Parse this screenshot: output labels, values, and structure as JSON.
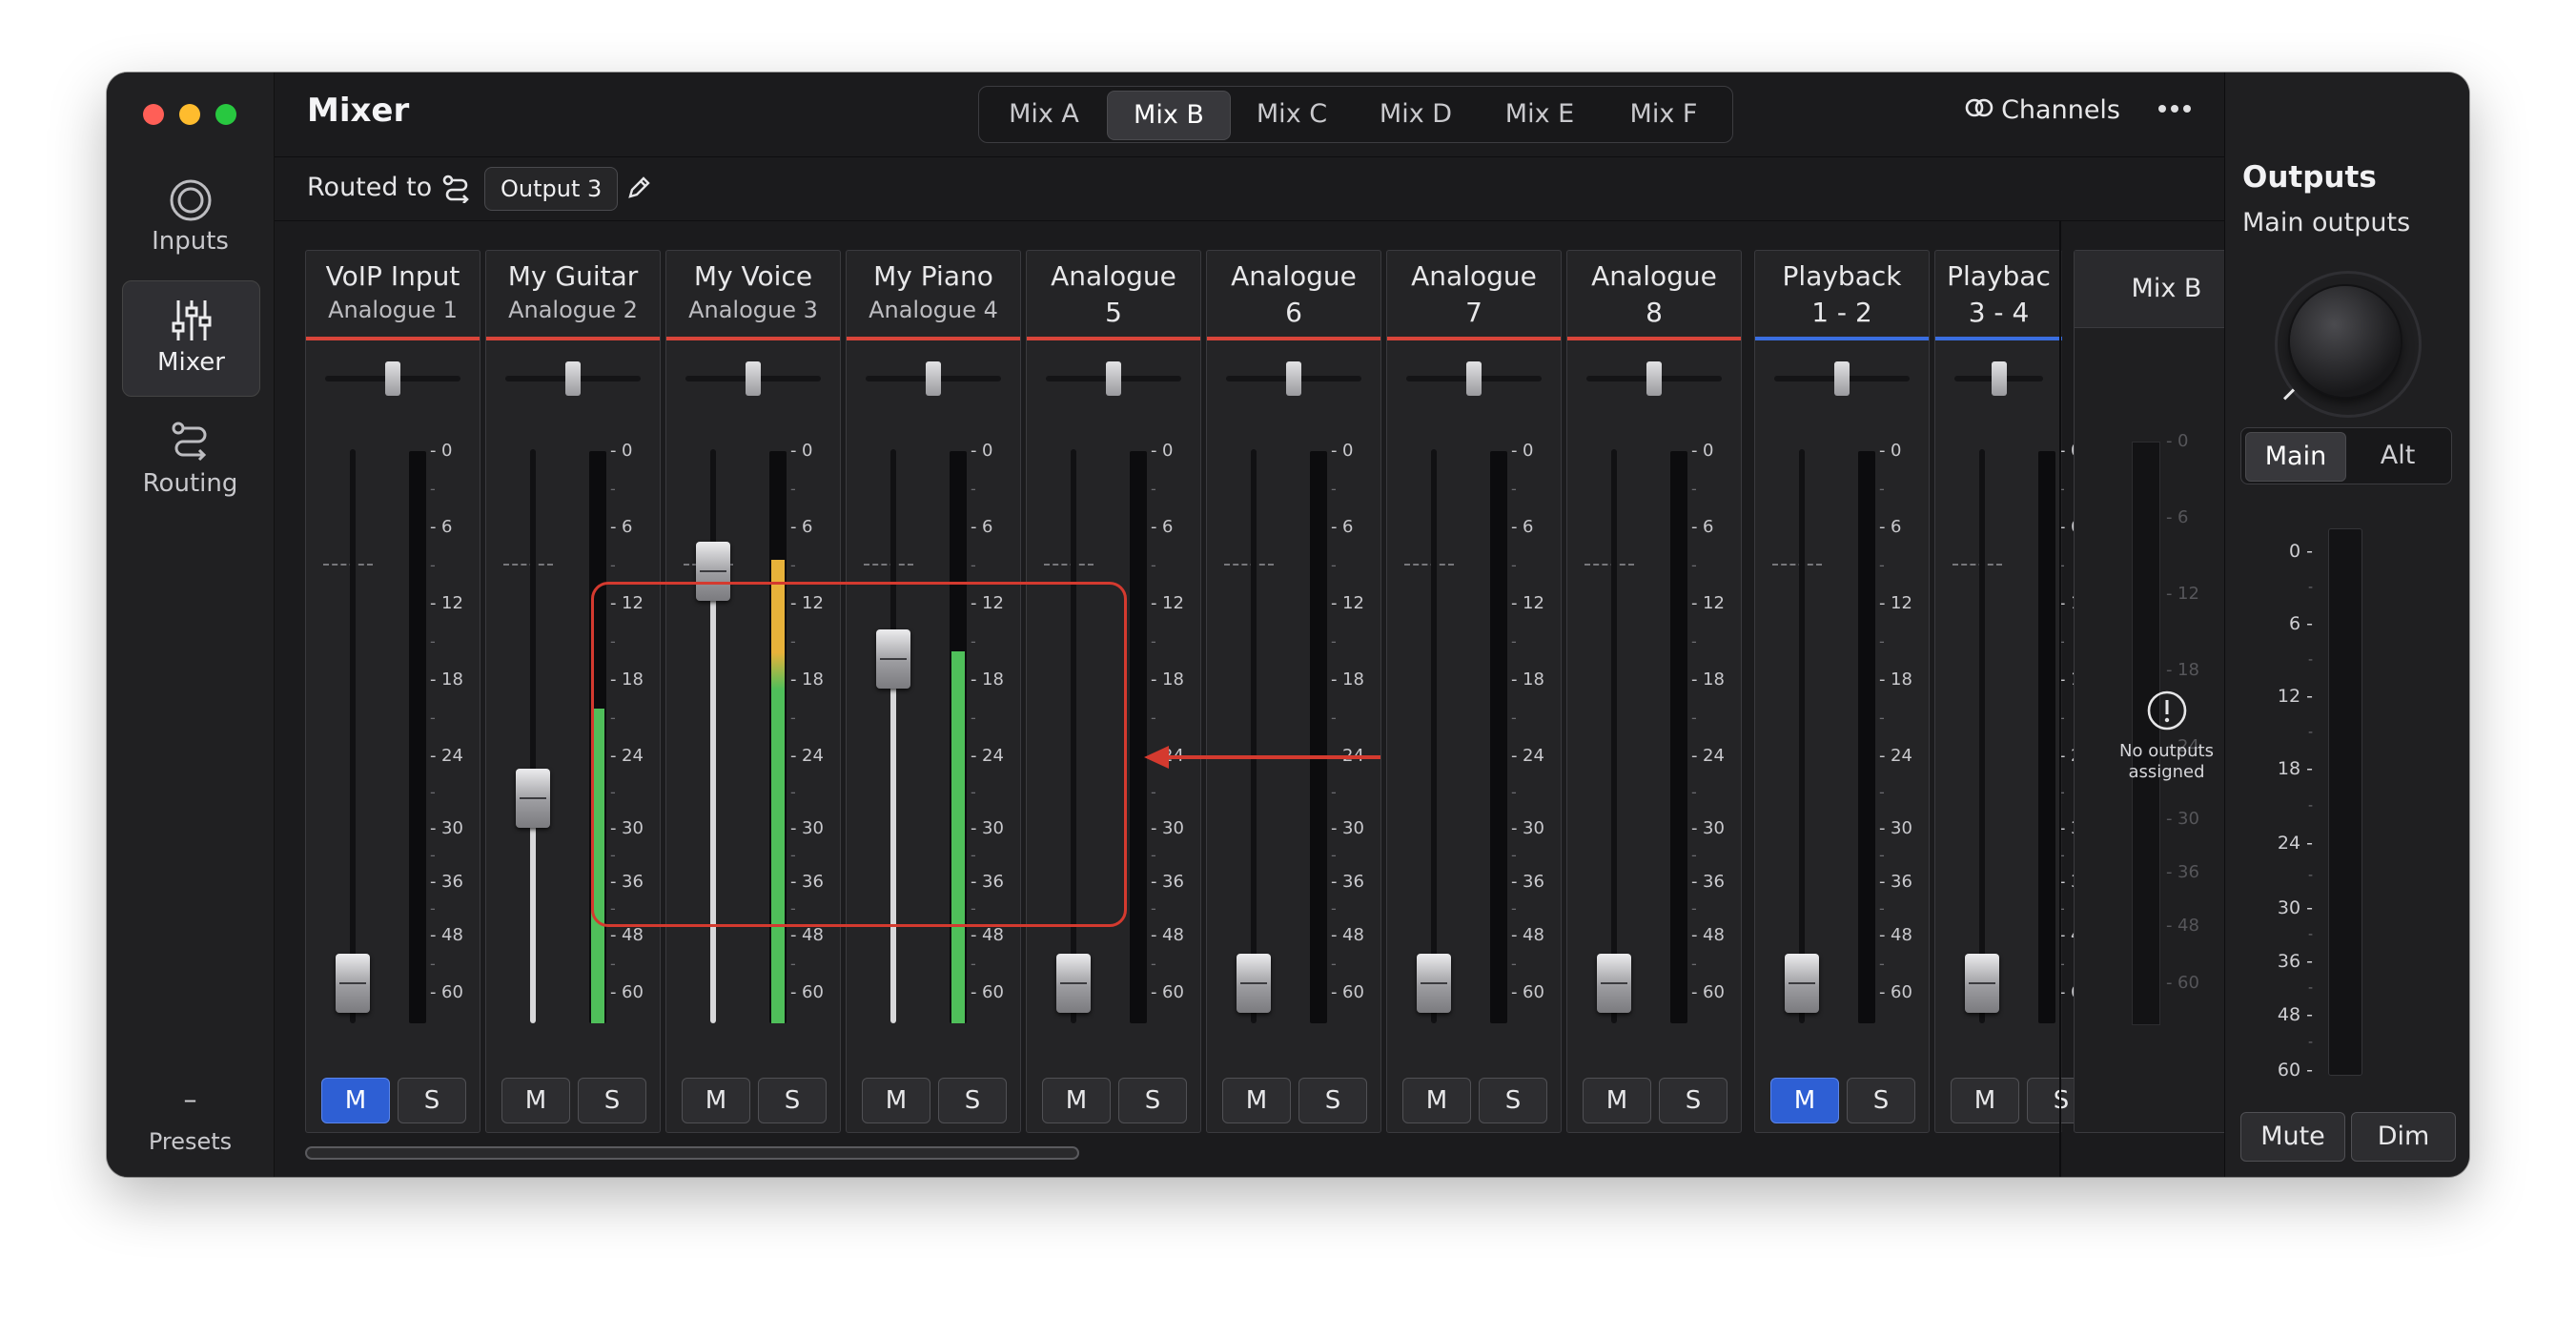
{
  "app": {
    "title": "Mixer"
  },
  "sidebar": {
    "items": [
      {
        "label": "Inputs",
        "icon": "inputs-icon"
      },
      {
        "label": "Mixer",
        "icon": "mixer-sliders-icon",
        "active": true
      },
      {
        "label": "Routing",
        "icon": "routing-icon"
      }
    ],
    "presets": {
      "dash": "–",
      "label": "Presets"
    }
  },
  "tabs": [
    "Mix A",
    "Mix B",
    "Mix C",
    "Mix D",
    "Mix E",
    "Mix F"
  ],
  "active_tab": "Mix B",
  "header": {
    "channels_label": "Channels",
    "more_icon": "more-icon"
  },
  "routing": {
    "label": "Routed to",
    "output": "Output 3"
  },
  "meter_scale": [
    "0",
    "6",
    "12",
    "18",
    "24",
    "30",
    "36",
    "48",
    "60"
  ],
  "channels": [
    {
      "name": "VoIP Input",
      "sub": "Analogue 1",
      "fader": 0.02,
      "meter": 0.0,
      "mute": true,
      "mute_label": "M",
      "solo_label": "S"
    },
    {
      "name": "My Guitar",
      "sub": "Analogue 2",
      "fader": 0.38,
      "meter": 0.55,
      "mute": false,
      "mute_label": "M",
      "solo_label": "S"
    },
    {
      "name": "My Voice",
      "sub": "Analogue 3",
      "fader": 0.82,
      "meter": 0.81,
      "mute": false,
      "mute_label": "M",
      "solo_label": "S"
    },
    {
      "name": "My Piano",
      "sub": "Analogue 4",
      "fader": 0.65,
      "meter": 0.65,
      "mute": false,
      "mute_label": "M",
      "solo_label": "S"
    },
    {
      "name": "Analogue",
      "sub": "5",
      "fader": 0.02,
      "meter": 0.0,
      "mute": false,
      "mute_label": "M",
      "solo_label": "S"
    },
    {
      "name": "Analogue",
      "sub": "6",
      "fader": 0.02,
      "meter": 0.0,
      "mute": false,
      "mute_label": "M",
      "solo_label": "S"
    },
    {
      "name": "Analogue",
      "sub": "7",
      "fader": 0.02,
      "meter": 0.0,
      "mute": false,
      "mute_label": "M",
      "solo_label": "S"
    },
    {
      "name": "Analogue",
      "sub": "8",
      "fader": 0.02,
      "meter": 0.0,
      "mute": false,
      "mute_label": "M",
      "solo_label": "S"
    },
    {
      "name": "Playback",
      "sub": "1 - 2",
      "fader": 0.02,
      "meter": 0.0,
      "mute": true,
      "mute_label": "M",
      "solo_label": "S",
      "playback": true
    },
    {
      "name": "Playbac",
      "sub": "3 - 4",
      "fader": 0.02,
      "meter": 0.0,
      "mute": false,
      "mute_label": "M",
      "solo_label": "S",
      "playback": true
    }
  ],
  "mix_column": {
    "title": "Mix B",
    "message": "No outputs assigned"
  },
  "outputs": {
    "title": "Outputs",
    "subtitle": "Main outputs",
    "segments": [
      "Main",
      "Alt"
    ],
    "active_segment": "Main",
    "scale": [
      "0",
      "6",
      "12",
      "18",
      "24",
      "30",
      "36",
      "48",
      "60"
    ],
    "mute_label": "Mute",
    "dim_label": "Dim"
  },
  "colors": {
    "accent_blue": "#2e5fd4",
    "input_bar": "#d9453a",
    "playback_bar": "#3a6ee0",
    "meter_green": "#4fbf5a",
    "meter_yellow": "#e8b23a",
    "annotation_red": "#d43a2f"
  }
}
